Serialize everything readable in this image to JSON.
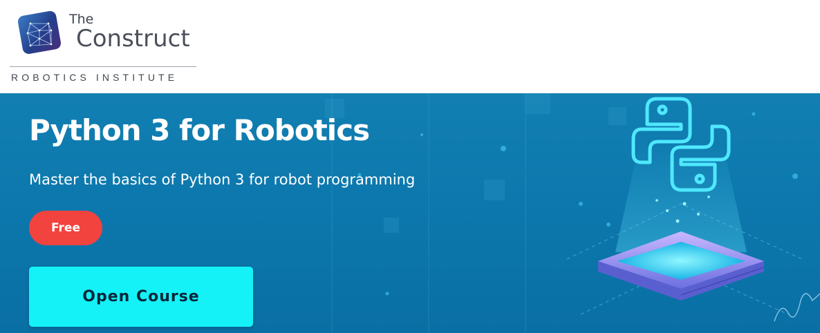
{
  "brand": {
    "the": "The",
    "name": "Construct",
    "tagline": "ROBOTICS INSTITUTE",
    "colors": {
      "logo_primary": "#1e3f8a",
      "logo_secondary": "#4a86c8",
      "text": "#4a505a"
    }
  },
  "course": {
    "title": "Python 3 for Robotics",
    "subtitle": "Master the basics of Python 3 for robot programming",
    "price_badge": "Free",
    "cta_label": "Open Course"
  },
  "icons": {
    "logo": "construct-logo-icon",
    "illustration": "python-logo-icon",
    "platform": "hologram-platform"
  },
  "colors": {
    "banner": "#0c78ad",
    "badge": "#f2433f",
    "cta": "#15f2f7",
    "cta_text": "#07263a",
    "glow": "#37d6ff"
  }
}
